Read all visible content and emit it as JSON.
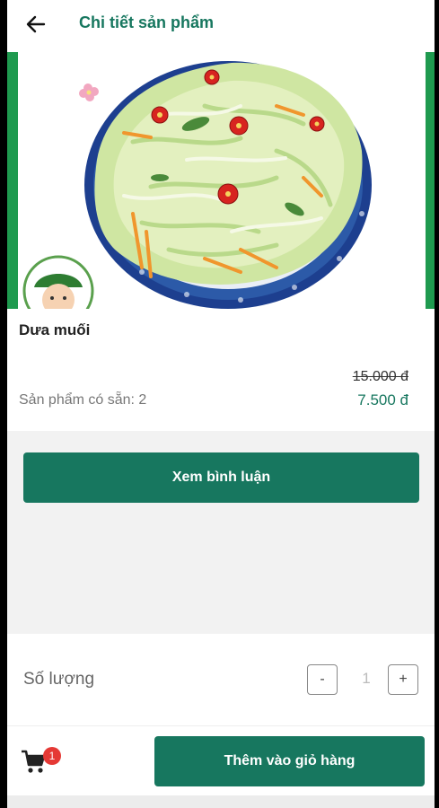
{
  "header": {
    "title": "Chi tiết sản phẩm"
  },
  "product": {
    "name": "Dưa muối",
    "old_price": "15.000 đ",
    "new_price": "7.500 đ",
    "stock_text": "Sản phẩm có sẵn: 2"
  },
  "actions": {
    "review_label": "Xem bình luận",
    "add_to_cart_label": "Thêm vào giỏ hàng"
  },
  "quantity": {
    "label": "Số lượng",
    "minus": "-",
    "value": "1",
    "plus": "+"
  },
  "cart": {
    "badge_count": "1"
  },
  "colors": {
    "primary": "#17775f",
    "badge": "#e53935",
    "accent_bar": "#1f9a4f"
  },
  "icons": [
    "back-arrow-icon",
    "cart-icon"
  ]
}
